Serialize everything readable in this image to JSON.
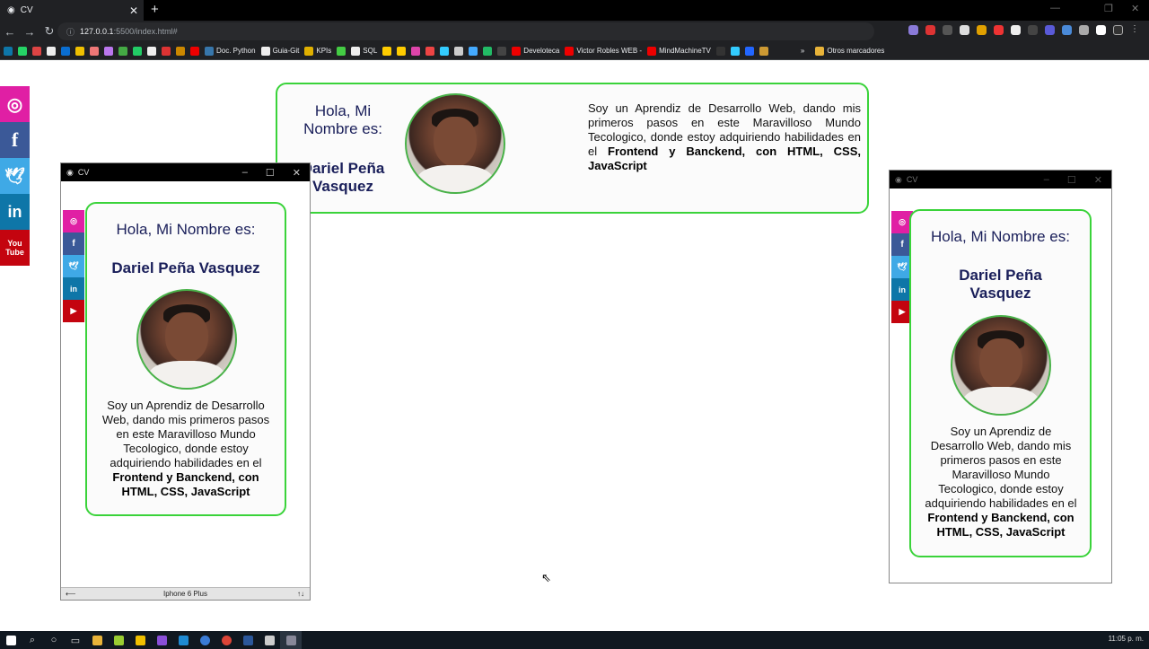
{
  "browser": {
    "tab_title": "CV",
    "tab_close": "✕",
    "new_tab": "+",
    "url_host": "127.0.0.1",
    "url_port": ":5500",
    "url_path": "/index.html#",
    "bookmarks": [
      "Doc. Python",
      "Guia-Git",
      "KPIs",
      "SQL",
      "Develoteca",
      "Victor Robles WEB -",
      "MindMachineTV"
    ],
    "other_bookmarks": "Otros marcadores"
  },
  "social": [
    "instagram",
    "facebook",
    "twitter",
    "linkedin",
    "youtube"
  ],
  "cv": {
    "greeting_wide": "Hola, Mi Nombre es:",
    "greeting": "Hola, Mi Nombre es:",
    "name": "Dariel Peña Vasquez",
    "bio_text": "Soy un Aprendiz de Desarrollo Web, dando mis primeros pasos en este Maravilloso Mundo Tecologico, donde estoy adquiriendo habilidades en el ",
    "bio_bold": "Frontend y Banckend, con HTML, CSS, JavaScript"
  },
  "device_window_1": {
    "title": "CV",
    "device_label": "Iphone 6 Plus"
  },
  "device_window_2": {
    "title": "CV"
  },
  "taskbar": {
    "time": "11:05 p. m."
  },
  "colors": {
    "instagram": "#e01fa4",
    "facebook": "#3b5998",
    "twitter": "#3fa9e6",
    "linkedin": "#0e76a8",
    "youtube": "#c4040f",
    "card_border": "#3ad33a",
    "title_navy": "#1a1f5a"
  }
}
